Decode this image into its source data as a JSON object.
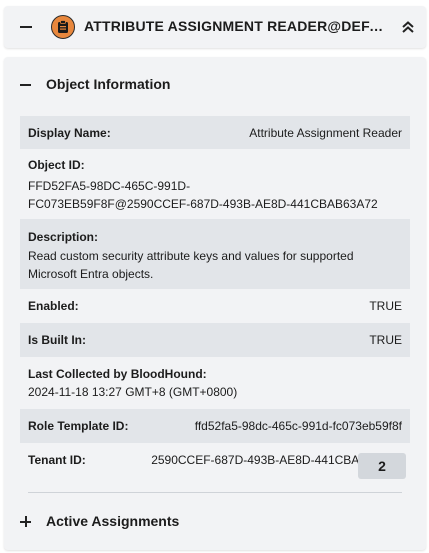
{
  "header": {
    "title": "ATTRIBUTE ASSIGNMENT READER@DEFAUL...",
    "icon": "role-icon",
    "accent_color": "#e8873d"
  },
  "object_information": {
    "title": "Object Information",
    "display_name": {
      "label": "Display Name:",
      "value": "Attribute Assignment Reader"
    },
    "object_id": {
      "label": "Object ID:",
      "value_line1": "FFD52FA5-98DC-465C-991D-",
      "value_line2": "FC073EB59F8F@2590CCEF-687D-493B-AE8D-441CBAB63A72"
    },
    "description": {
      "label": "Description:",
      "value_line1": "Read custom security attribute keys and values for supported",
      "value_line2": "Microsoft Entra objects."
    },
    "enabled": {
      "label": "Enabled:",
      "value": "TRUE"
    },
    "is_built_in": {
      "label": "Is Built In:",
      "value": "TRUE"
    },
    "last_collected": {
      "label": "Last Collected by BloodHound:",
      "value": "2024-11-18 13:27 GMT+8 (GMT+0800)"
    },
    "role_template_id": {
      "label": "Role Template ID:",
      "value": "ffd52fa5-98dc-465c-991d-fc073eb59f8f"
    },
    "tenant_id": {
      "label": "Tenant ID:",
      "value": "2590CCEF-687D-493B-AE8D-441CBAB63A72"
    }
  },
  "active_assignments": {
    "title": "Active Assignments",
    "count": "2"
  }
}
